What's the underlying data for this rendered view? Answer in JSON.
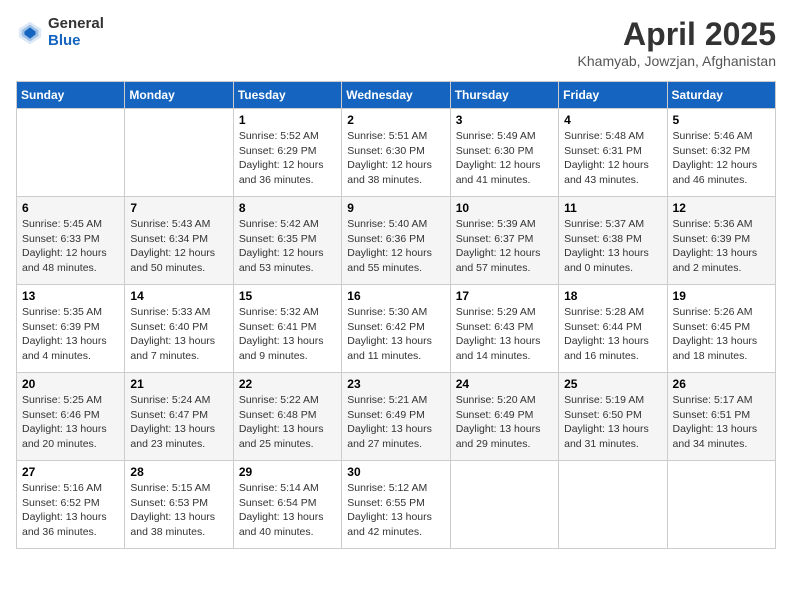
{
  "logo": {
    "general": "General",
    "blue": "Blue"
  },
  "title": "April 2025",
  "subtitle": "Khamyab, Jowzjan, Afghanistan",
  "days_of_week": [
    "Sunday",
    "Monday",
    "Tuesday",
    "Wednesday",
    "Thursday",
    "Friday",
    "Saturday"
  ],
  "weeks": [
    [
      {
        "day": "",
        "info": ""
      },
      {
        "day": "",
        "info": ""
      },
      {
        "day": "1",
        "info": "Sunrise: 5:52 AM\nSunset: 6:29 PM\nDaylight: 12 hours and 36 minutes."
      },
      {
        "day": "2",
        "info": "Sunrise: 5:51 AM\nSunset: 6:30 PM\nDaylight: 12 hours and 38 minutes."
      },
      {
        "day": "3",
        "info": "Sunrise: 5:49 AM\nSunset: 6:30 PM\nDaylight: 12 hours and 41 minutes."
      },
      {
        "day": "4",
        "info": "Sunrise: 5:48 AM\nSunset: 6:31 PM\nDaylight: 12 hours and 43 minutes."
      },
      {
        "day": "5",
        "info": "Sunrise: 5:46 AM\nSunset: 6:32 PM\nDaylight: 12 hours and 46 minutes."
      }
    ],
    [
      {
        "day": "6",
        "info": "Sunrise: 5:45 AM\nSunset: 6:33 PM\nDaylight: 12 hours and 48 minutes."
      },
      {
        "day": "7",
        "info": "Sunrise: 5:43 AM\nSunset: 6:34 PM\nDaylight: 12 hours and 50 minutes."
      },
      {
        "day": "8",
        "info": "Sunrise: 5:42 AM\nSunset: 6:35 PM\nDaylight: 12 hours and 53 minutes."
      },
      {
        "day": "9",
        "info": "Sunrise: 5:40 AM\nSunset: 6:36 PM\nDaylight: 12 hours and 55 minutes."
      },
      {
        "day": "10",
        "info": "Sunrise: 5:39 AM\nSunset: 6:37 PM\nDaylight: 12 hours and 57 minutes."
      },
      {
        "day": "11",
        "info": "Sunrise: 5:37 AM\nSunset: 6:38 PM\nDaylight: 13 hours and 0 minutes."
      },
      {
        "day": "12",
        "info": "Sunrise: 5:36 AM\nSunset: 6:39 PM\nDaylight: 13 hours and 2 minutes."
      }
    ],
    [
      {
        "day": "13",
        "info": "Sunrise: 5:35 AM\nSunset: 6:39 PM\nDaylight: 13 hours and 4 minutes."
      },
      {
        "day": "14",
        "info": "Sunrise: 5:33 AM\nSunset: 6:40 PM\nDaylight: 13 hours and 7 minutes."
      },
      {
        "day": "15",
        "info": "Sunrise: 5:32 AM\nSunset: 6:41 PM\nDaylight: 13 hours and 9 minutes."
      },
      {
        "day": "16",
        "info": "Sunrise: 5:30 AM\nSunset: 6:42 PM\nDaylight: 13 hours and 11 minutes."
      },
      {
        "day": "17",
        "info": "Sunrise: 5:29 AM\nSunset: 6:43 PM\nDaylight: 13 hours and 14 minutes."
      },
      {
        "day": "18",
        "info": "Sunrise: 5:28 AM\nSunset: 6:44 PM\nDaylight: 13 hours and 16 minutes."
      },
      {
        "day": "19",
        "info": "Sunrise: 5:26 AM\nSunset: 6:45 PM\nDaylight: 13 hours and 18 minutes."
      }
    ],
    [
      {
        "day": "20",
        "info": "Sunrise: 5:25 AM\nSunset: 6:46 PM\nDaylight: 13 hours and 20 minutes."
      },
      {
        "day": "21",
        "info": "Sunrise: 5:24 AM\nSunset: 6:47 PM\nDaylight: 13 hours and 23 minutes."
      },
      {
        "day": "22",
        "info": "Sunrise: 5:22 AM\nSunset: 6:48 PM\nDaylight: 13 hours and 25 minutes."
      },
      {
        "day": "23",
        "info": "Sunrise: 5:21 AM\nSunset: 6:49 PM\nDaylight: 13 hours and 27 minutes."
      },
      {
        "day": "24",
        "info": "Sunrise: 5:20 AM\nSunset: 6:49 PM\nDaylight: 13 hours and 29 minutes."
      },
      {
        "day": "25",
        "info": "Sunrise: 5:19 AM\nSunset: 6:50 PM\nDaylight: 13 hours and 31 minutes."
      },
      {
        "day": "26",
        "info": "Sunrise: 5:17 AM\nSunset: 6:51 PM\nDaylight: 13 hours and 34 minutes."
      }
    ],
    [
      {
        "day": "27",
        "info": "Sunrise: 5:16 AM\nSunset: 6:52 PM\nDaylight: 13 hours and 36 minutes."
      },
      {
        "day": "28",
        "info": "Sunrise: 5:15 AM\nSunset: 6:53 PM\nDaylight: 13 hours and 38 minutes."
      },
      {
        "day": "29",
        "info": "Sunrise: 5:14 AM\nSunset: 6:54 PM\nDaylight: 13 hours and 40 minutes."
      },
      {
        "day": "30",
        "info": "Sunrise: 5:12 AM\nSunset: 6:55 PM\nDaylight: 13 hours and 42 minutes."
      },
      {
        "day": "",
        "info": ""
      },
      {
        "day": "",
        "info": ""
      },
      {
        "day": "",
        "info": ""
      }
    ]
  ]
}
